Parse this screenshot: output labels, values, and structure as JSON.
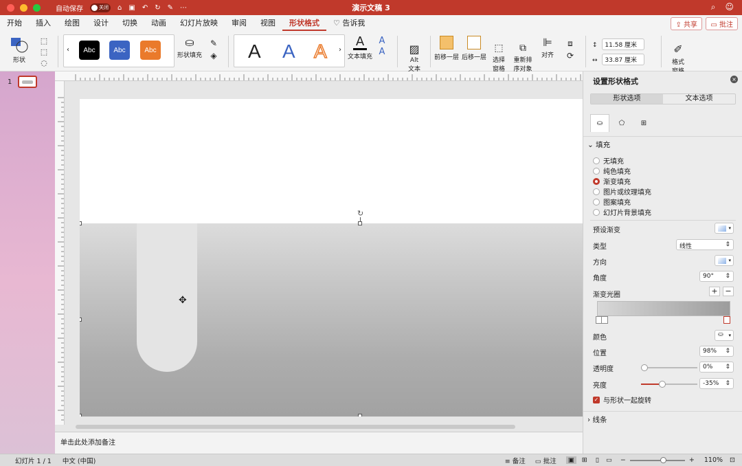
{
  "window": {
    "title": "演示文稿 3",
    "autosave_label": "自动保存",
    "autosave_state": "关闭"
  },
  "tabs": [
    "开始",
    "插入",
    "绘图",
    "设计",
    "切换",
    "动画",
    "幻灯片放映",
    "审阅",
    "视图",
    "形状格式",
    "告诉我"
  ],
  "active_tab": "形状格式",
  "share_label": "共享",
  "comment_label": "批注",
  "ribbon": {
    "shape_label": "形状",
    "style_samples": [
      "Abc",
      "Abc",
      "Abc"
    ],
    "style_colors": [
      "#000000",
      "#3b64c2",
      "#ea7a2b"
    ],
    "shape_fill_label": "形状填充",
    "wordart": [
      "A",
      "A",
      "A"
    ],
    "text_fill_label": "文本填充",
    "alt_text_label": "Alt\n文本",
    "bring_forward": "前移一层",
    "send_backward": "后移一层",
    "selection_pane": "选择\n窗格",
    "reorder": "重新排\n序对象",
    "align": "对齐",
    "height_value": "11.58 厘米",
    "width_value": "33.87 厘米",
    "format_pane": "格式\n窗格"
  },
  "slide_number": "1",
  "notes_placeholder": "单击此处添加备注",
  "status": {
    "slide_info": "幻灯片 1 / 1",
    "language": "中文 (中国)",
    "notes": "备注",
    "comments": "批注",
    "zoom": "110%"
  },
  "pane": {
    "title": "设置形状格式",
    "tab_shape": "形状选项",
    "tab_text": "文本选项",
    "fill_section": "填充",
    "fill_options": [
      "无填充",
      "纯色填充",
      "渐变填充",
      "图片或纹理填充",
      "图案填充",
      "幻灯片背景填充"
    ],
    "selected_fill": "渐变填充",
    "preset_label": "预设渐变",
    "type_label": "类型",
    "type_value": "线性",
    "direction_label": "方向",
    "angle_label": "角度",
    "angle_value": "90°",
    "stops_label": "渐变光圈",
    "color_label": "颜色",
    "position_label": "位置",
    "position_value": "98%",
    "transparency_label": "透明度",
    "transparency_value": "0%",
    "brightness_label": "亮度",
    "brightness_value": "-35%",
    "rotate_with_shape": "与形状一起旋转",
    "line_section": "线条"
  }
}
